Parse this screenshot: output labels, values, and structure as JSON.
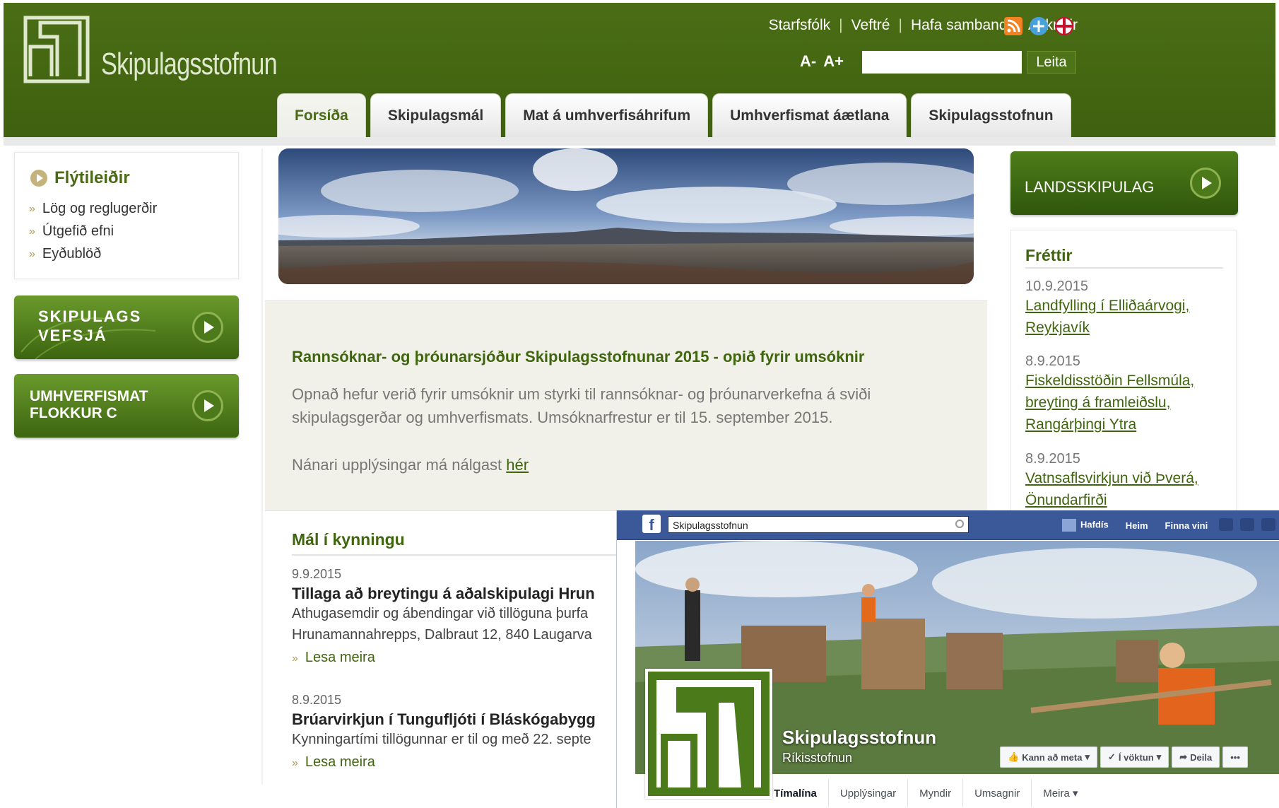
{
  "header": {
    "logo_text": "Skipulagsstofnun",
    "top_links": [
      "Starfsfólk",
      "Veftré",
      "Hafa samband",
      "Askriftir"
    ],
    "font_smaller": "A-",
    "font_larger": "A+",
    "search_value": "",
    "search_button": "Leita"
  },
  "tabs": [
    {
      "label": "Forsíða",
      "active": true
    },
    {
      "label": "Skipulagsmál"
    },
    {
      "label": "Mat á umhverfisáhrifum"
    },
    {
      "label": "Umhverfismat áætlana"
    },
    {
      "label": "Skipulagsstofnun"
    }
  ],
  "sidebar": {
    "title": "Flýtileiðir",
    "items": [
      "Lög og reglugerðir",
      "Útgefið efni",
      "Eyðublöð"
    ],
    "button1": "SKIPULAGS\nVEFSJÁ",
    "button2": "UMHVERFISMAT\nFLOKKUR C"
  },
  "notice": {
    "title": "Rannsóknar- og þróunarsjóður Skipulagsstofnunar 2015 - opið fyrir umsóknir",
    "body": "Opnað hefur verið fyrir umsóknir um styrki til rannsóknar- og þróunarverkefna á sviði skipulagsgerðar og umhverfismats. Umsóknarfrestur er til 15. september 2015.",
    "more_prefix": "Nánari upplýsingar má nálgast ",
    "more_link": "hér"
  },
  "kynning": {
    "heading": "Mál í kynningu",
    "items": [
      {
        "date": "9.9.2015",
        "title": "Tillaga að breytingu á aðalskipulagi Hrun",
        "text1": "Athugasemdir og ábendingar við tillöguna þurfa",
        "text2": "Hrunamannahrepps, Dalbraut 12, 840 Laugarva",
        "more": "Lesa meira"
      },
      {
        "date": "8.9.2015",
        "title": "Brúarvirkjun í Tungufljóti í Bláskógabygg",
        "text1": "Kynningartími tillögunnar er til og með 22. septe",
        "more": "Lesa meira"
      }
    ]
  },
  "right": {
    "landsskipulag": "LANDSSKIPULAG",
    "news_title": "Fréttir",
    "news": [
      {
        "date": "10.9.2015",
        "lines": [
          "Landfylling í Elliðaárvogi,",
          "Reykjavík"
        ]
      },
      {
        "date": "8.9.2015",
        "lines": [
          "Fiskeldisstöðin Fellsmúla,",
          "breyting á framleiðslu,",
          "Rangárþingi Ytra"
        ]
      },
      {
        "date": "8.9.2015",
        "lines": [
          "Vatnsaflsvirkjun við Þverá,",
          "Önundarfirði"
        ]
      }
    ]
  },
  "facebook": {
    "search_value": "Skipulagsstofnun",
    "nav": [
      "Hafdís",
      "Heim",
      "Finna vini"
    ],
    "page_name": "Skipulagsstofnun",
    "category": "Ríkisstofnun",
    "buttons": [
      "Kann að meta",
      "Í vöktun",
      "Deila",
      "•••"
    ],
    "tabs": [
      "Tímalína",
      "Upplýsingar",
      "Myndir",
      "Umsagnir",
      "Meira ▾"
    ]
  },
  "colors": {
    "header_green": "#4a6d15",
    "link_green": "#40650f",
    "facebook_blue": "#3b5998"
  }
}
